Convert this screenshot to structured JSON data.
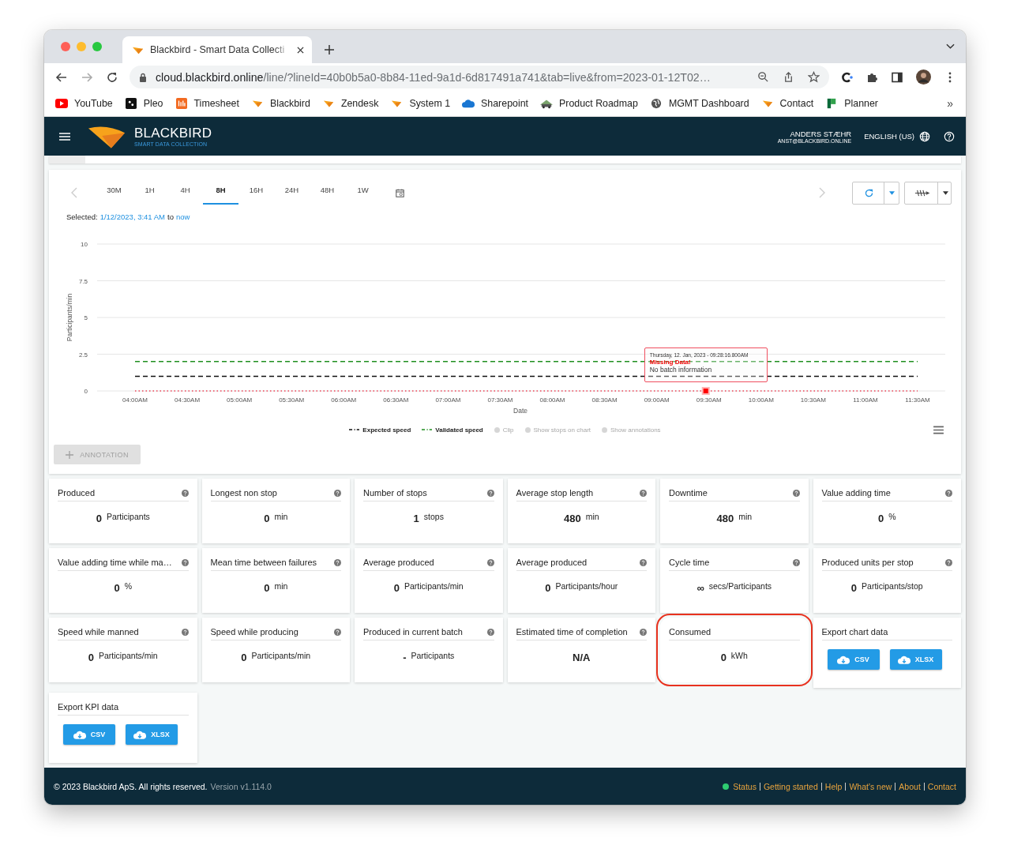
{
  "browser": {
    "tabs": [
      {
        "title": "Blackbird - Smart Data Collecti",
        "selected": true
      }
    ],
    "url": {
      "host": "cloud.blackbird.online",
      "path": "/line/?lineId=40b0b5a0-8b84-11ed-9a1d-6d817491a741&tab=live&from=2023-01-12T02…"
    },
    "bookmarks": [
      {
        "label": "YouTube",
        "kind": "play"
      },
      {
        "label": "Pleo",
        "kind": "tile"
      },
      {
        "label": "Timesheet",
        "kind": "bars"
      },
      {
        "label": "Blackbird",
        "kind": "bird"
      },
      {
        "label": "Zendesk",
        "kind": "bird"
      },
      {
        "label": "System 1",
        "kind": "bird"
      },
      {
        "label": "Sharepoint",
        "kind": "cloud"
      },
      {
        "label": "Product Roadmap",
        "kind": "car"
      },
      {
        "label": "MGMT Dashboard",
        "kind": "globe"
      },
      {
        "label": "Contact",
        "kind": "bird"
      },
      {
        "label": "Planner",
        "kind": "flag"
      }
    ],
    "overflow": "»"
  },
  "header": {
    "brand": "BLACKBIRD",
    "tagline": "SMART DATA COLLECTION",
    "user": {
      "name": "ANDERS STÆHR",
      "email": "ANST@BLACKBIRD.ONLINE"
    },
    "language": "ENGLISH (US)"
  },
  "chart": {
    "ranges": [
      {
        "label": "30M",
        "selected": false
      },
      {
        "label": "1H",
        "selected": false
      },
      {
        "label": "4H",
        "selected": false
      },
      {
        "label": "8H",
        "selected": true
      },
      {
        "label": "16H",
        "selected": false
      },
      {
        "label": "24H",
        "selected": false
      },
      {
        "label": "48H",
        "selected": false
      },
      {
        "label": "1W",
        "selected": false
      }
    ],
    "selection": {
      "label": "Selected:",
      "from": "1/12/2023, 3:41 AM",
      "joiner": "to",
      "to": "now"
    },
    "chart_data": {
      "type": "line",
      "xlabel": "Date",
      "ylabel": "Participants/min",
      "categories": [
        "04:00AM",
        "04:30AM",
        "05:00AM",
        "05:30AM",
        "06:00AM",
        "06:30AM",
        "07:00AM",
        "07:30AM",
        "08:00AM",
        "08:30AM",
        "09:00AM",
        "09:30AM",
        "10:00AM",
        "10:30AM",
        "11:00AM",
        "11:30AM"
      ],
      "ylim": [
        0,
        10
      ],
      "yticks": [
        0,
        2.5,
        5,
        7.5,
        10
      ],
      "series": [
        {
          "name": "Expected speed",
          "color": "#111111",
          "line_style": "dashed",
          "values": [
            1,
            1,
            1,
            1,
            1,
            1,
            1,
            1,
            1,
            1,
            1,
            1,
            1,
            1,
            1,
            1
          ]
        },
        {
          "name": "Validated speed",
          "color": "#1f8f1f",
          "line_style": "dashed",
          "values": [
            2,
            2,
            2,
            2,
            2,
            2,
            2,
            2,
            2,
            2,
            2,
            2,
            2,
            2,
            2,
            2
          ]
        },
        {
          "color": "#f0455a",
          "line_style": "dotted",
          "values": [
            0,
            0,
            0,
            0,
            0,
            0,
            0,
            0,
            0,
            0,
            0,
            0,
            0,
            0,
            0,
            0
          ]
        }
      ],
      "grid": true,
      "annotations": [
        {
          "x": "09:30AM"
        }
      ]
    },
    "tooltips": [
      {
        "date": "Thursday, 12. Jan, 2023 - 09:28:16.800AM",
        "title": "Missing Data!",
        "text": "No batch information"
      }
    ],
    "legend_toggles": [
      {
        "label": "Clip",
        "enabled": false
      },
      {
        "label": "Show stops on chart",
        "enabled": false
      },
      {
        "label": "Show annotations",
        "enabled": false
      }
    ],
    "annotation_button": {
      "label": "ANNOTATION",
      "disabled": true
    }
  },
  "cards": [
    {
      "kind": "kpi",
      "title": "Produced",
      "value": "0",
      "unit": "Participants",
      "help": true,
      "highlighted": false
    },
    {
      "kind": "kpi",
      "title": "Longest non stop",
      "value": "0",
      "unit": "min",
      "help": true,
      "highlighted": false
    },
    {
      "kind": "kpi",
      "title": "Number of stops",
      "value": "1",
      "unit": "stops",
      "help": true,
      "highlighted": false
    },
    {
      "kind": "kpi",
      "title": "Average stop length",
      "value": "480",
      "unit": "min",
      "help": true,
      "highlighted": false
    },
    {
      "kind": "kpi",
      "title": "Downtime",
      "value": "480",
      "unit": "min",
      "help": true,
      "highlighted": false
    },
    {
      "kind": "kpi",
      "title": "Value adding time",
      "value": "0",
      "unit": "%",
      "help": true,
      "highlighted": false
    },
    {
      "kind": "kpi",
      "title": "Value adding time while ma…",
      "value": "0",
      "unit": "%",
      "help": true,
      "highlighted": false
    },
    {
      "kind": "kpi",
      "title": "Mean time between failures",
      "value": "0",
      "unit": "min",
      "help": true,
      "highlighted": false
    },
    {
      "kind": "kpi",
      "title": "Average produced",
      "value": "0",
      "unit": "Participants/min",
      "help": true,
      "highlighted": false
    },
    {
      "kind": "kpi",
      "title": "Average produced",
      "value": "0",
      "unit": "Participants/hour",
      "help": true,
      "highlighted": false
    },
    {
      "kind": "kpi",
      "title": "Cycle time",
      "value": "∞",
      "unit": "secs/Participants",
      "help": true,
      "highlighted": false
    },
    {
      "kind": "kpi",
      "title": "Produced units per stop",
      "value": "0",
      "unit": "Participants/stop",
      "help": true,
      "highlighted": false
    },
    {
      "kind": "kpi",
      "title": "Speed while manned",
      "value": "0",
      "unit": "Participants/min",
      "help": true,
      "highlighted": false
    },
    {
      "kind": "kpi",
      "title": "Speed while producing",
      "value": "0",
      "unit": "Participants/min",
      "help": true,
      "highlighted": false
    },
    {
      "kind": "kpi",
      "title": "Produced in current batch",
      "value": "-",
      "unit": "Participants",
      "help": true,
      "highlighted": false
    },
    {
      "kind": "kpi",
      "title": "Estimated time of completion",
      "value": "N/A",
      "help": true,
      "highlighted": false
    },
    {
      "kind": "kpi",
      "title": "Consumed",
      "value": "0",
      "unit": "kWh",
      "help": false,
      "highlighted": true
    },
    {
      "kind": "export",
      "title": "Export chart data",
      "buttons": [
        "CSV",
        "XLSX"
      ]
    },
    {
      "kind": "export",
      "title": "Export KPI data",
      "buttons": [
        "CSV",
        "XLSX"
      ]
    }
  ],
  "footer": {
    "copyright": "© 2023 Blackbird ApS. All rights reserved.",
    "version": "Version v1.114.0",
    "status": {
      "label": "Status",
      "color": "#2ecc71"
    },
    "links": [
      "Getting started",
      "Help",
      "What's new",
      "About",
      "Contact"
    ]
  }
}
